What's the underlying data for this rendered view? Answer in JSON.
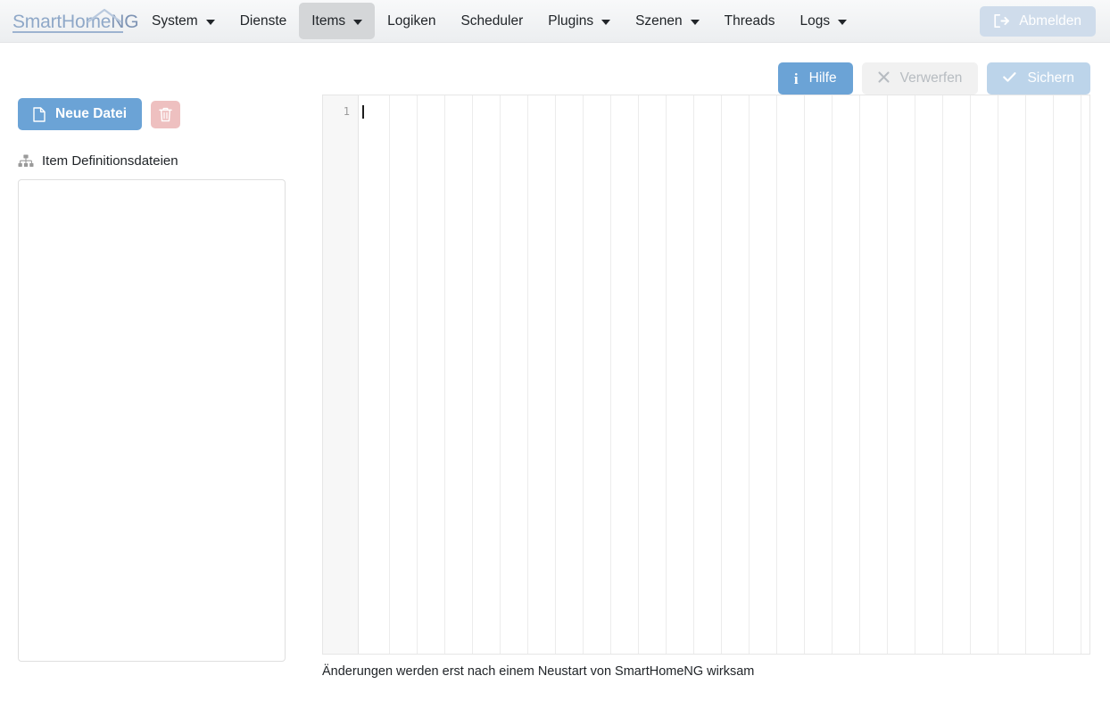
{
  "navbar": {
    "brand": {
      "text_light": "SmartHome",
      "text_ng": "NG",
      "full": "SmartHomeNG"
    },
    "items": [
      {
        "label": "System",
        "has_caret": true,
        "active": false
      },
      {
        "label": "Dienste",
        "has_caret": false,
        "active": false
      },
      {
        "label": "Items",
        "has_caret": true,
        "active": true
      },
      {
        "label": "Logiken",
        "has_caret": false,
        "active": false
      },
      {
        "label": "Scheduler",
        "has_caret": false,
        "active": false
      },
      {
        "label": "Plugins",
        "has_caret": true,
        "active": false
      },
      {
        "label": "Szenen",
        "has_caret": true,
        "active": false
      },
      {
        "label": "Threads",
        "has_caret": false,
        "active": false
      },
      {
        "label": "Logs",
        "has_caret": true,
        "active": false
      }
    ],
    "logout": {
      "label": "Abmelden",
      "icon": "sign-out-icon"
    }
  },
  "action_bar": {
    "help": {
      "label": "Hilfe",
      "icon": "info-icon",
      "state": "enabled"
    },
    "discard": {
      "label": "Verwerfen",
      "icon": "times-icon",
      "state": "disabled"
    },
    "save": {
      "label": "Sichern",
      "icon": "check-icon",
      "state": "disabled"
    }
  },
  "sidebar": {
    "new_file": {
      "label": "Neue Datei",
      "icon": "file-icon"
    },
    "delete": {
      "label": "",
      "icon": "trash-icon"
    },
    "list_label": "Item Definitionsdateien",
    "list_icon": "sitemap-icon",
    "files": []
  },
  "editor": {
    "lines": [
      "1"
    ],
    "content": "",
    "note": "Änderungen werden erst nach einem Neustart von SmartHomeNG wirksam"
  },
  "colors": {
    "accent_blue": "#6ba3d6",
    "save_blue": "#bcd4ea",
    "logout_blue": "#cfdceb",
    "danger_pink": "#eec0c0",
    "brand_blue": "#8fa8c8",
    "navbar_bg": "#eceef0",
    "active_tab": "#d4d6d8"
  }
}
